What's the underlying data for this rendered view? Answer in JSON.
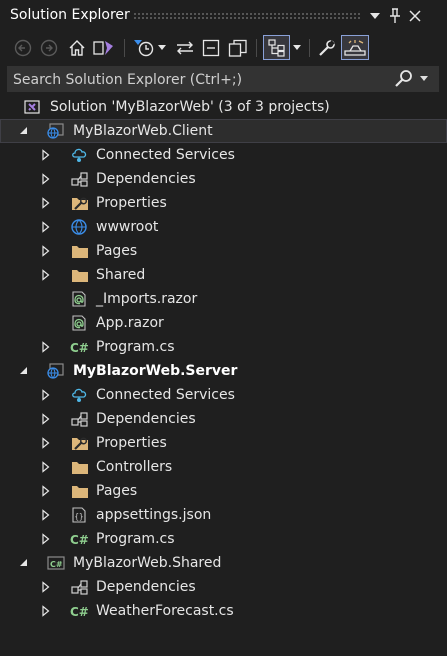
{
  "panel": {
    "title": "Solution Explorer"
  },
  "search": {
    "placeholder": "Search Solution Explorer (Ctrl+;)"
  },
  "tree": {
    "solution": "Solution 'MyBlazorWeb' (3 of 3 projects)",
    "client": {
      "name": "MyBlazorWeb.Client",
      "items": [
        "Connected Services",
        "Dependencies",
        "Properties",
        "wwwroot",
        "Pages",
        "Shared",
        "_Imports.razor",
        "App.razor",
        "Program.cs"
      ]
    },
    "server": {
      "name": "MyBlazorWeb.Server",
      "items": [
        "Connected Services",
        "Dependencies",
        "Properties",
        "Controllers",
        "Pages",
        "appsettings.json",
        "Program.cs"
      ]
    },
    "shared": {
      "name": "MyBlazorWeb.Shared",
      "items": [
        "Dependencies",
        "WeatherForecast.cs"
      ]
    }
  },
  "colors": {
    "background": "#1f1f1f",
    "folder": "#dcb67a",
    "csharp": "#8fce8f",
    "globe": "#3b8eea",
    "vs_purple": "#a57fe0"
  }
}
